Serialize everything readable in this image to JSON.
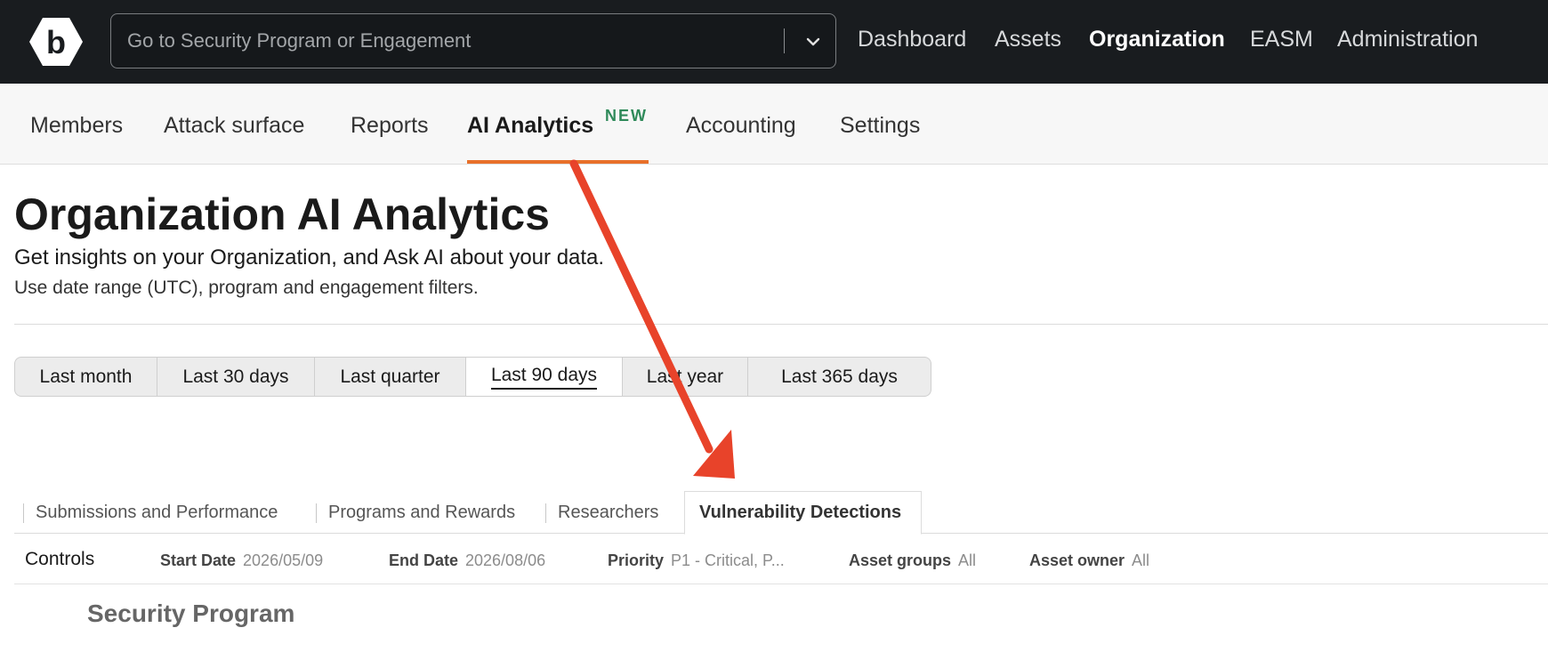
{
  "topbar": {
    "search_placeholder": "Go to Security Program or Engagement",
    "nav": [
      "Dashboard",
      "Assets",
      "Organization",
      "EASM",
      "Administration"
    ],
    "active": "Organization"
  },
  "subnav": {
    "items": [
      "Members",
      "Attack surface",
      "Reports",
      "AI Analytics",
      "Accounting",
      "Settings"
    ],
    "active": "AI Analytics",
    "badge": "NEW"
  },
  "page": {
    "title": "Organization AI Analytics",
    "subtitle": "Get insights on your Organization, and Ask AI about your data.",
    "hint": "Use date range (UTC), program and engagement filters."
  },
  "ranges": {
    "options": [
      "Last month",
      "Last 30 days",
      "Last quarter",
      "Last 90 days",
      "Last year",
      "Last 365 days"
    ],
    "selected": "Last 90 days"
  },
  "tabs": {
    "items": [
      "Submissions and Performance",
      "Programs and Rewards",
      "Researchers",
      "Vulnerability Detections"
    ],
    "active": "Vulnerability Detections"
  },
  "controls": {
    "label": "Controls",
    "filters": [
      {
        "key": "Start Date",
        "value": "2026/05/09"
      },
      {
        "key": "End Date",
        "value": "2026/08/06"
      },
      {
        "key": "Priority",
        "value": "P1 - Critical, P..."
      },
      {
        "key": "Asset groups",
        "value": "All"
      },
      {
        "key": "Asset owner",
        "value": "All"
      }
    ]
  },
  "section_title": "Security Program",
  "colors": {
    "topbar": "#191c1f",
    "accent_underline": "#e8702a",
    "badge": "#2f8a5a",
    "annotation_arrow": "#e8432a"
  }
}
